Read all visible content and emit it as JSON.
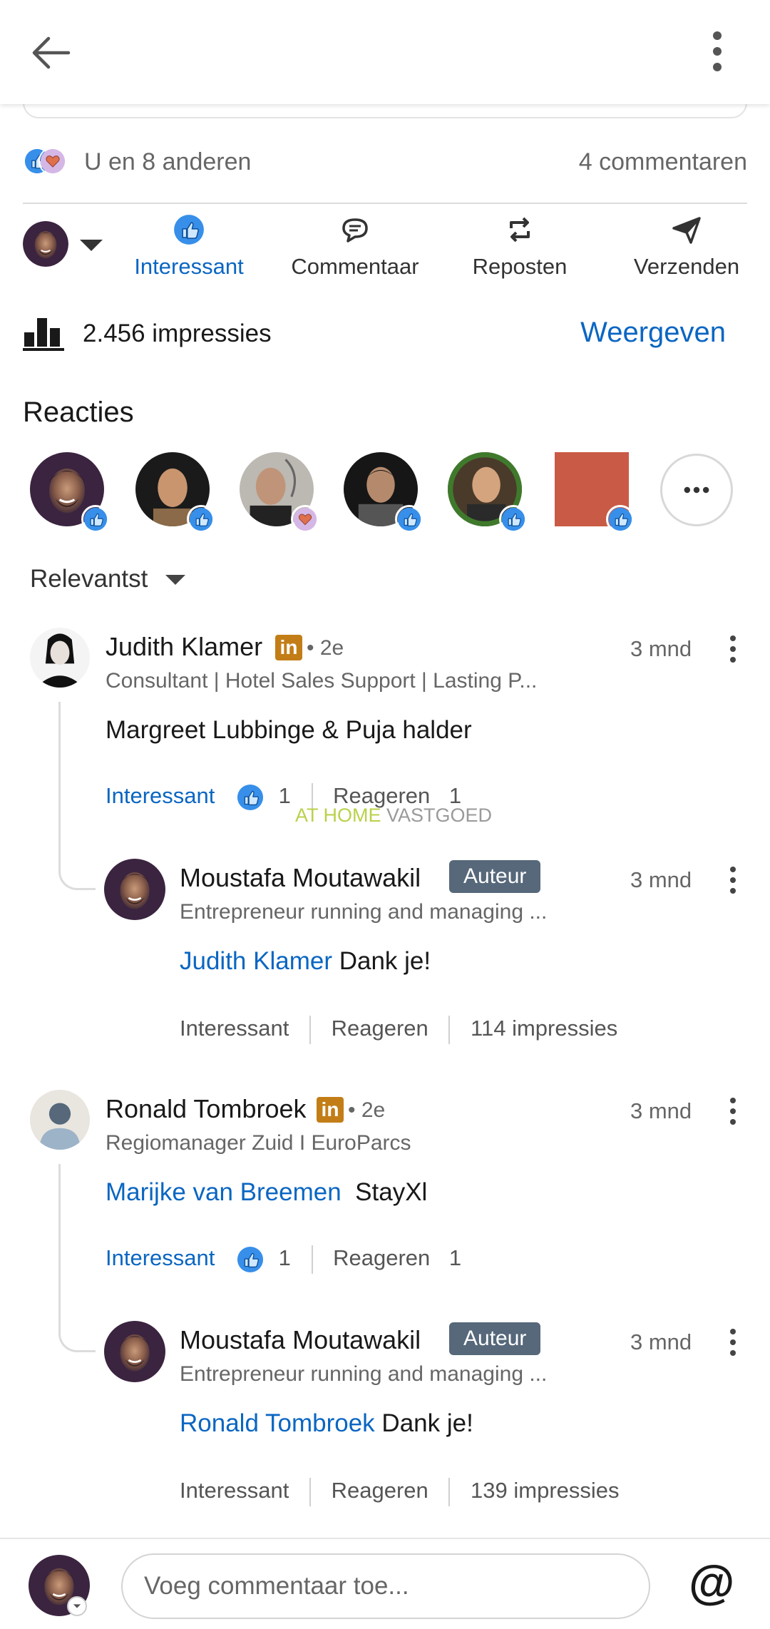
{
  "social": {
    "summary": "U en 8 anderen",
    "comments": "4 commentaren"
  },
  "actions": {
    "interessant": "Interessant",
    "commentaar": "Commentaar",
    "reposten": "Reposten",
    "verzenden": "Verzenden"
  },
  "impressions": {
    "text": "2.456 impressies",
    "link": "Weergeven"
  },
  "reactions": {
    "heading": "Reacties",
    "more_icon": "ellipsis-icon"
  },
  "sort": {
    "label": "Relevantst"
  },
  "watermark": {
    "part1": "AT HOME",
    "part2": "VASTGOED"
  },
  "comments": [
    {
      "name": "Judith Klamer",
      "in_badge": "in",
      "degree": "• 2e",
      "time": "3 mnd",
      "headline": "Consultant | Hotel Sales Support | Lasting P...",
      "body": "Margreet Lubbinge & Puja halder",
      "like": "Interessant",
      "like_count": "1",
      "reply": "Reageren",
      "reply_count": "1",
      "reply_item": {
        "name": "Moustafa Moutawakil",
        "badge": "Auteur",
        "time": "3 mnd",
        "headline": "Entrepreneur running and managing ...",
        "mention": "Judith Klamer",
        "body": "Dank je!",
        "like": "Interessant",
        "reply": "Reageren",
        "impressions": "114 impressies"
      }
    },
    {
      "name": "Ronald Tombroek",
      "in_badge": "in",
      "degree": "• 2e",
      "time": "3 mnd",
      "headline": "Regiomanager Zuid I EuroParcs",
      "mention": "Marijke van Breemen",
      "body": "StayXl",
      "like": "Interessant",
      "like_count": "1",
      "reply": "Reageren",
      "reply_count": "1",
      "reply_item": {
        "name": "Moustafa Moutawakil",
        "badge": "Auteur",
        "time": "3 mnd",
        "headline": "Entrepreneur running and managing ...",
        "mention": "Ronald Tombroek",
        "body": "Dank je!",
        "like": "Interessant",
        "reply": "Reageren",
        "impressions": "139 impressies"
      }
    }
  ],
  "composer": {
    "placeholder": "Voeg commentaar toe...",
    "at_symbol": "@"
  },
  "colors": {
    "accent": "#0a66c2",
    "in_badge": "#c37d16",
    "auteur_badge": "#56687a"
  }
}
